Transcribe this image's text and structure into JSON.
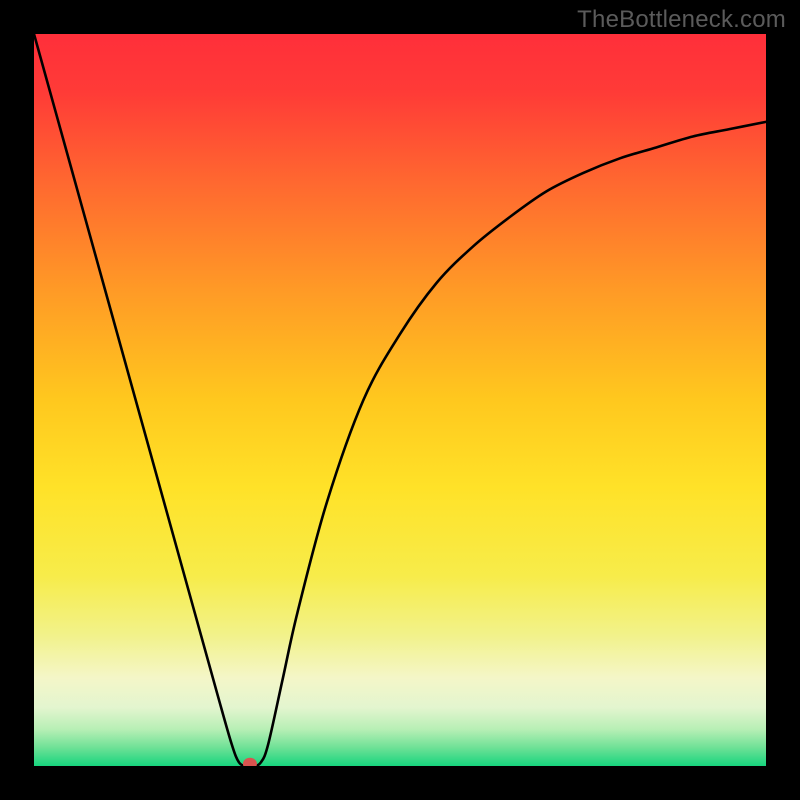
{
  "watermark": "TheBottleneck.com",
  "chart_data": {
    "type": "line",
    "title": "",
    "xlabel": "",
    "ylabel": "",
    "xlim": [
      0,
      100
    ],
    "ylim": [
      0,
      100
    ],
    "grid": false,
    "series": [
      {
        "name": "curve",
        "x": [
          0,
          5,
          10,
          15,
          20,
          25,
          27,
          28,
          29,
          30,
          31,
          32,
          34,
          36,
          40,
          45,
          50,
          55,
          60,
          65,
          70,
          75,
          80,
          85,
          90,
          95,
          100
        ],
        "y": [
          100,
          82,
          64,
          46,
          28,
          10,
          3,
          0.5,
          0,
          0,
          0.5,
          3,
          12,
          21,
          36,
          50,
          59,
          66,
          71,
          75,
          78.5,
          81,
          83,
          84.5,
          86,
          87,
          88
        ]
      }
    ],
    "marker": {
      "x": 29.5,
      "y": 0.3,
      "color": "#d9534f"
    },
    "background_gradient": {
      "stops": [
        {
          "offset": 0.0,
          "color": "#ff2f3a"
        },
        {
          "offset": 0.08,
          "color": "#ff3b37"
        },
        {
          "offset": 0.2,
          "color": "#ff6730"
        },
        {
          "offset": 0.35,
          "color": "#ff9a26"
        },
        {
          "offset": 0.5,
          "color": "#ffc81e"
        },
        {
          "offset": 0.62,
          "color": "#ffe228"
        },
        {
          "offset": 0.74,
          "color": "#f7ec4a"
        },
        {
          "offset": 0.82,
          "color": "#f2f289"
        },
        {
          "offset": 0.88,
          "color": "#f4f6c8"
        },
        {
          "offset": 0.92,
          "color": "#e3f5cf"
        },
        {
          "offset": 0.95,
          "color": "#b7efb5"
        },
        {
          "offset": 0.975,
          "color": "#6ee196"
        },
        {
          "offset": 1.0,
          "color": "#17d57e"
        }
      ]
    }
  }
}
